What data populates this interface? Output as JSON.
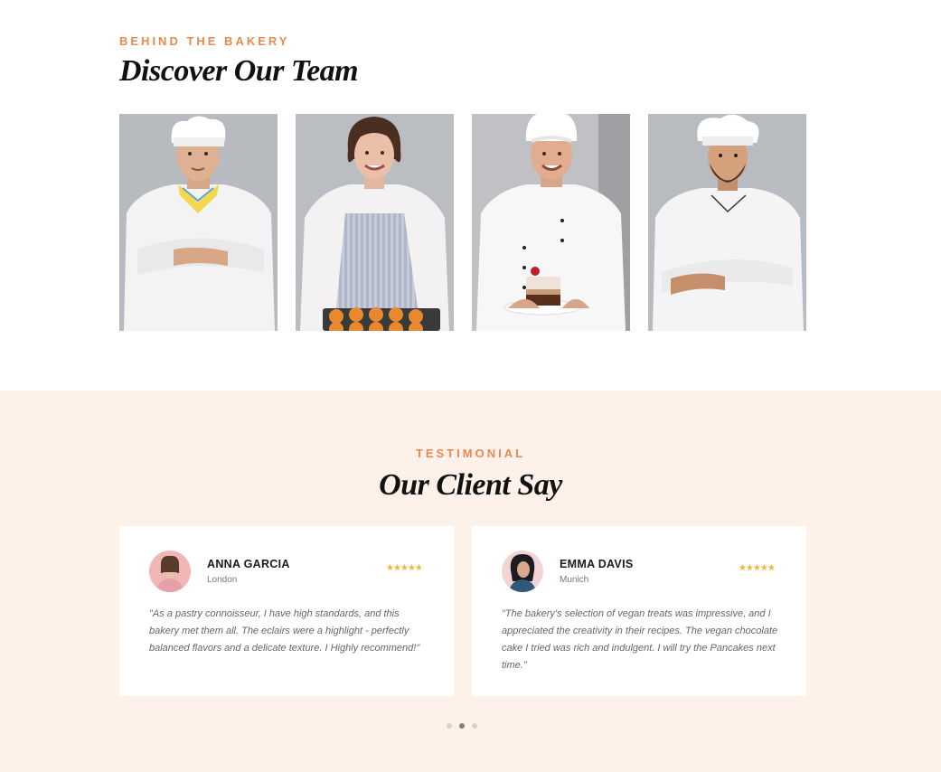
{
  "team_section": {
    "eyebrow": "BEHIND THE BAKERY",
    "title": "Discover Our Team",
    "members": [
      {
        "image": "chef-crossed-arms-photo"
      },
      {
        "image": "baker-woman-muffins-photo"
      },
      {
        "image": "chef-cake-slice-photo"
      },
      {
        "image": "bearded-chef-photo"
      }
    ]
  },
  "testimonial_section": {
    "eyebrow": "TESTIMONIAL",
    "title": "Our Client Say",
    "testimonials": [
      {
        "name": "ANNA GARCIA",
        "city": "London",
        "rating": 5,
        "stars": "★★★★★",
        "quote": "\"As a pastry connoisseur, I have high standards, and this bakery met them all. The eclairs were a highlight - perfectly balanced flavors and a delicate texture. I Highly recommend!\""
      },
      {
        "name": "EMMA DAVIS",
        "city": "Munich",
        "rating": 5,
        "stars": "★★★★★",
        "quote": "\"The bakery's selection of vegan treats was impressive, and I appreciated the creativity in their recipes. The vegan chocolate cake I tried was rich and indulgent. I will try the Pancakes next time.\""
      }
    ],
    "pagination": {
      "total": 3,
      "active": 2
    }
  },
  "colors": {
    "accent": "#e68a4e",
    "testimonial_bg": "#fdf1e9",
    "star": "#f2b33d",
    "photo_bg": "#b9bcc1"
  }
}
